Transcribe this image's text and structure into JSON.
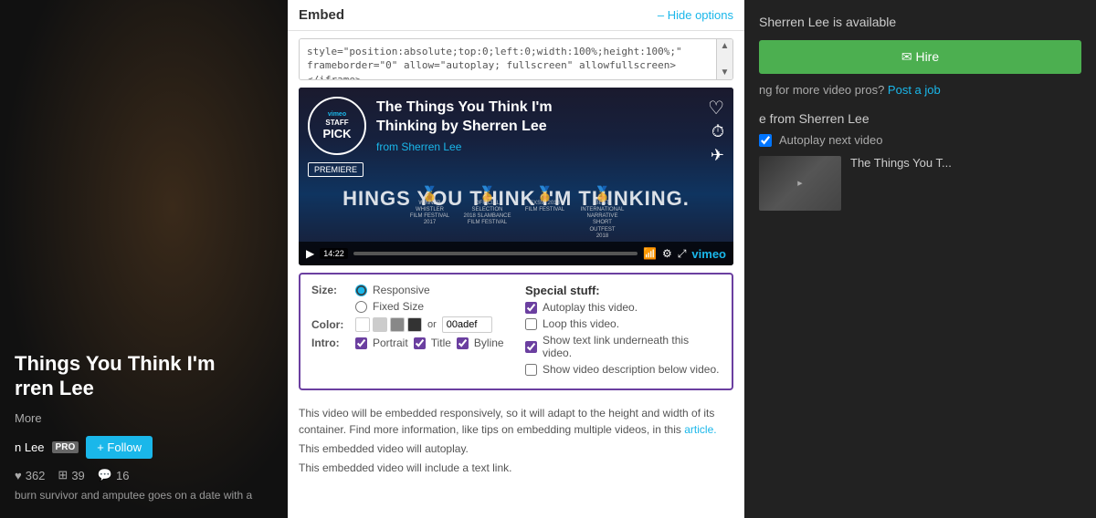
{
  "background": {
    "leftPanel": {
      "videoTitle": "Things You Think I'm",
      "videoTitle2": "rren Lee",
      "moreLabel": "More",
      "authorName": "n Lee",
      "proBadge": "PRO",
      "followButton": "+ Follow",
      "stats": {
        "likes": "362",
        "layers": "39",
        "comments": "16"
      },
      "description": "burn survivor and amputee goes on a date with a"
    },
    "rightPanel": {
      "availableText": "Sherren Lee is available",
      "hireButton": "✉ Hire",
      "lookingForText": "ng for more video pros?",
      "postJobLink": "Post a job",
      "moreFromTitle": "e from Sherren Lee",
      "autoplayLabel": "Autoplay next video",
      "thumbnailTitle": "The Things You T..."
    }
  },
  "embed": {
    "title": "Embed",
    "hideOptions": "– Hide options",
    "codeValue": "style=\"position:absolute;top:0;left:0;width:100%;height:100%;\" frameborder=\"0\" allow=\"autoplay; fullscreen\" allowfullscreen></iframe>",
    "video": {
      "staffPickLabel": "STAFF\nPICK",
      "vimeoLabel": "vimeo",
      "premiereLabel": "PREMIERE",
      "titleLine1": "The Things You Think I'm",
      "titleLine2": "Thinking by Sherren Lee",
      "fromLabel": "from",
      "fromAuthor": "Sherren Lee",
      "bigText": "HINGS YOU THINK I'M THINKING.",
      "duration": "14:22",
      "awards": [
        {
          "name": "WHISTLER FILM FESTIVAL 2017",
          "laurel": "❧"
        },
        {
          "name": "OFFICIAL SELECTION 2018 SLAMBANCE FILM FESTIVAL",
          "laurel": "❧"
        },
        {
          "name": "SXSW 2018 FILM FESTIVAL",
          "laurel": "❧"
        },
        {
          "name": "BEST INTERNATIONAL NARRATIVE SHORT OUTFEST 2018",
          "laurel": "❧"
        }
      ]
    },
    "options": {
      "sizeLabel": "Size:",
      "responsiveLabel": "Responsive",
      "fixedSizeLabel": "Fixed Size",
      "colorLabel": "Color:",
      "colorOr": "or",
      "colorHex": "00adef",
      "swatchColors": [
        "#fff",
        "#ccc",
        "#888",
        "#333"
      ],
      "introLabel": "Intro:",
      "portraitLabel": "Portrait",
      "titleLabel": "Title",
      "bylineLabel": "Byline",
      "specialStuffLabel": "Special stuff:",
      "autoplayLabel": "Autoplay this video.",
      "loopLabel": "Loop this video.",
      "showTextLinkLabel": "Show text link underneath this video.",
      "showDescriptionLabel": "Show video description below video.",
      "responsiveChecked": true,
      "fixedSizeChecked": false,
      "autoplayChecked": true,
      "loopChecked": false,
      "showTextLinkChecked": true,
      "showDescriptionChecked": false,
      "portraitChecked": true,
      "titleChecked": true,
      "bylineChecked": true
    },
    "description": {
      "line1": "This video will be embedded responsively, so it will adapt to the height and width of its",
      "line2": "container. Find more information, like tips on embedding multiple videos, in this",
      "articleLink": "article.",
      "line3": "This embedded video will autoplay.",
      "line4": "This embedded video will include a text link."
    }
  }
}
